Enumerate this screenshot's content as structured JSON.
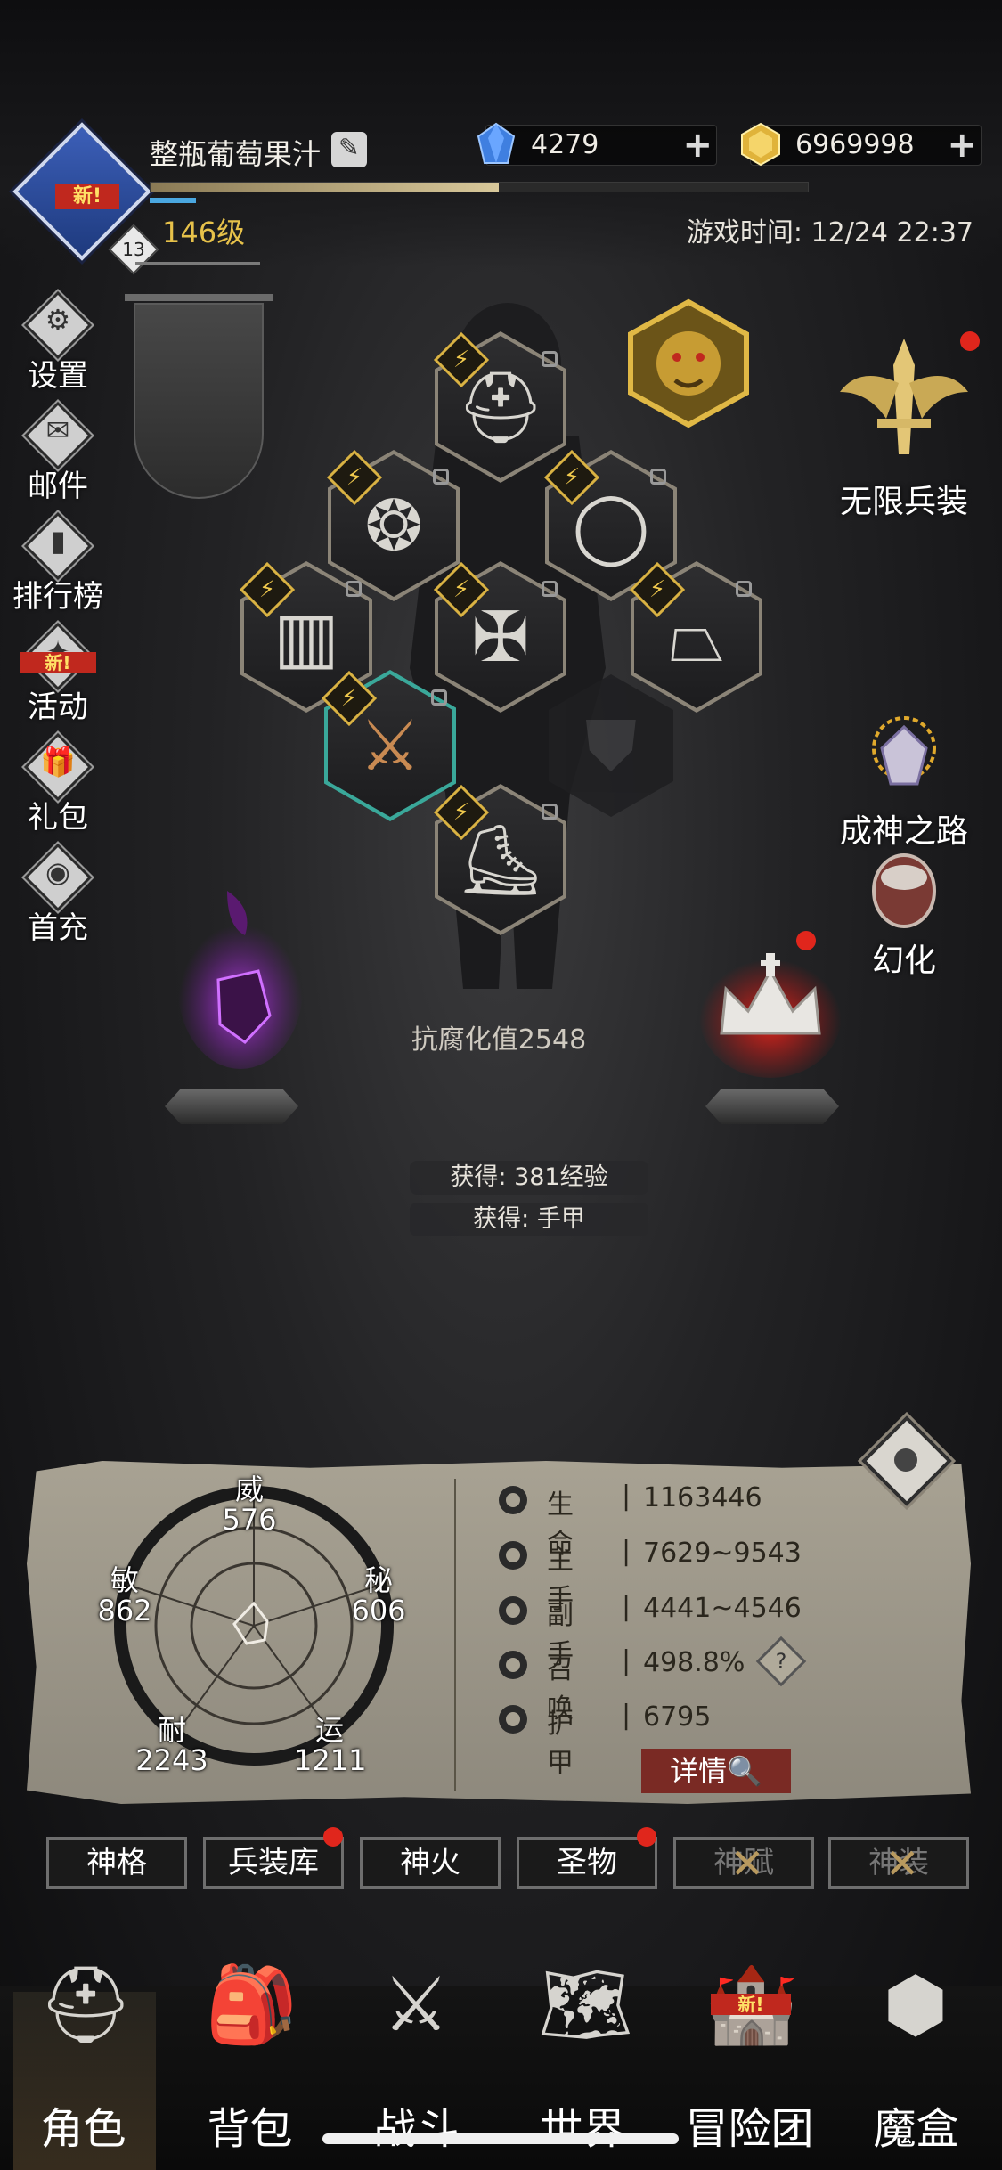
{
  "header": {
    "player_name": "整瓶葡萄果汁",
    "level_text": "146级",
    "avatar_new_tag": "新!",
    "avatar_level_badge": "13",
    "exp_progress": 0.53,
    "game_time_text": "游戏时间: 12/24 22:37",
    "currencies": {
      "gems": "4279",
      "gold": "6969998"
    }
  },
  "left_menu": [
    {
      "label": "设置",
      "icon": "gear-icon"
    },
    {
      "label": "邮件",
      "icon": "mail-icon"
    },
    {
      "label": "排行榜",
      "icon": "ranking-icon"
    },
    {
      "label": "活动",
      "icon": "event-icon",
      "badge": "新!"
    },
    {
      "label": "礼包",
      "icon": "gift-icon"
    },
    {
      "label": "首充",
      "icon": "first-recharge-icon"
    }
  ],
  "right_features": {
    "infinite_weapons": "无限兵装",
    "path_to_godhood": "成神之路",
    "transmog": "幻化"
  },
  "equipment_slots": [
    "helmet",
    "amulet",
    "ring",
    "pants",
    "chest-armor",
    "cloak",
    "weapon",
    "offhand-shield",
    "boots"
  ],
  "corruption_text": "抗腐化值2548",
  "gains": [
    "获得: 381经验",
    "获得: 手甲"
  ],
  "stats_panel": {
    "radar": {
      "top": {
        "name": "威",
        "value": "576"
      },
      "right": {
        "name": "秘",
        "value": "606"
      },
      "bottom_right": {
        "name": "运",
        "value": "1211"
      },
      "bottom_left": {
        "name": "耐",
        "value": "2243"
      },
      "left": {
        "name": "敏",
        "value": "862"
      }
    },
    "stats": [
      {
        "name": "生命",
        "value": "1163446",
        "icon": "heart-icon"
      },
      {
        "name": "主手",
        "value": "7629~9543",
        "icon": "sword-icon"
      },
      {
        "name": "副手",
        "value": "4441~4546",
        "icon": "dagger-icon"
      },
      {
        "name": "召唤",
        "value": "498.8%",
        "icon": "summon-icon"
      },
      {
        "name": "护甲",
        "value": "6795",
        "icon": "armor-icon"
      }
    ],
    "separator": "|",
    "help": "?",
    "detail_button": "详情"
  },
  "sub_tabs": [
    {
      "label": "神格",
      "locked": false
    },
    {
      "label": "兵装库",
      "locked": false
    },
    {
      "label": "神火",
      "locked": false
    },
    {
      "label": "圣物",
      "locked": false
    },
    {
      "label": "神赋",
      "locked": true
    },
    {
      "label": "神装",
      "locked": true
    }
  ],
  "bottom_nav": [
    {
      "label": "角色",
      "icon": "helmet-icon",
      "active": true
    },
    {
      "label": "背包",
      "icon": "backpack-icon"
    },
    {
      "label": "战斗",
      "icon": "crossed-swords-shield-icon"
    },
    {
      "label": "世界",
      "icon": "map-icon"
    },
    {
      "label": "冒险团",
      "icon": "castle-icon",
      "badge": "新!"
    },
    {
      "label": "魔盒",
      "icon": "cube-icon"
    }
  ],
  "colors": {
    "level_gold": "#e6c14a",
    "detail_red": "#7a2a24",
    "notify_red": "#e0261c"
  }
}
